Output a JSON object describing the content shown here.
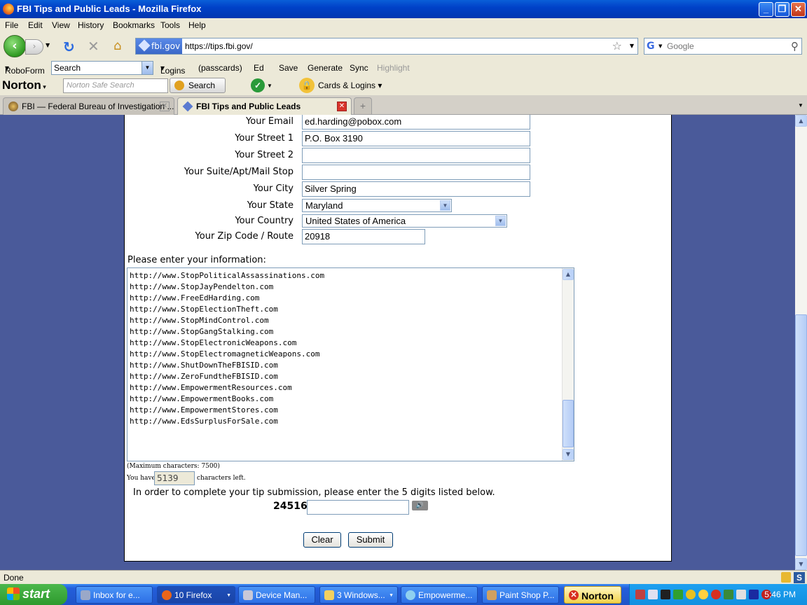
{
  "window": {
    "title": "FBI Tips and Public Leads - Mozilla Firefox"
  },
  "menubar": [
    "File",
    "Edit",
    "View",
    "History",
    "Bookmarks",
    "Tools",
    "Help"
  ],
  "navbar": {
    "site_badge": "fbi.gov",
    "url": "https://tips.fbi.gov/",
    "search_placeholder": "Google"
  },
  "roboform": {
    "brand": "RoboForm",
    "search_value": "Search",
    "logins": "Logins",
    "passcards": "(passcards)",
    "user": "Ed",
    "save": "Save",
    "generate": "Generate",
    "sync": "Sync",
    "highlight": "Highlight"
  },
  "norton": {
    "logo": "Norton",
    "search_placeholder": "Norton Safe Search",
    "search_button": "Search",
    "cards_logins": "Cards & Logins"
  },
  "tabs": [
    {
      "label": "FBI — Federal Bureau of Investigation ...",
      "active": false
    },
    {
      "label": "FBI Tips and Public Leads",
      "active": true
    }
  ],
  "form": {
    "fields": [
      {
        "label": "Your Email",
        "value": "ed.harding@pobox.com"
      },
      {
        "label": "Your Street 1",
        "value": "P.O. Box 3190"
      },
      {
        "label": "Your Street 2",
        "value": ""
      },
      {
        "label": "Your Suite/Apt/Mail Stop",
        "value": ""
      },
      {
        "label": "Your City",
        "value": "Silver Spring"
      }
    ],
    "state": {
      "label": "Your State",
      "value": "Maryland"
    },
    "country": {
      "label": "Your Country",
      "value": "United States of America"
    },
    "zip": {
      "label": "Your Zip Code / Route",
      "value": "20918"
    },
    "info_label": "Please enter your information:",
    "info_lines": [
      "http://www.StopPoliticalAssassinations.com",
      "http://www.StopJayPendelton.com",
      "http://www.FreeEdHarding.com",
      "http://www.StopElectionTheft.com",
      "http://www.StopMindControl.com",
      "http://www.StopGangStalking.com",
      "http://www.StopElectronicWeapons.com",
      "http://www.StopElectromagneticWeapons.com",
      "http://www.ShutDownTheFBISID.com",
      "http://www.ZeroFundtheFBISID.com",
      "http://www.EmpowermentResources.com",
      "http://www.EmpowermentBooks.com",
      "http://www.EmpowermentStores.com",
      "http://www.EdsSurplusForSale.com"
    ],
    "max_chars": "(Maximum characters: 7500)",
    "you_have": "You have",
    "chars_remaining": "5139",
    "chars_left": "characters left.",
    "instruction": "In order to complete your tip submission, please enter the 5 digits listed below.",
    "captcha_digits": "24516",
    "clear_button": "Clear",
    "submit_button": "Submit"
  },
  "status": {
    "text": "Done"
  },
  "taskbar": {
    "start": "start",
    "tasks": [
      {
        "label": "Inbox for e...",
        "color": "#9aa8c8"
      },
      {
        "label": "10 Firefox",
        "color": "#e8651a"
      },
      {
        "label": "Device Man...",
        "color": "#c8c8d8"
      },
      {
        "label": "3 Windows...",
        "color": "#f2d060"
      },
      {
        "label": "Empowerme...",
        "color": "#8fd0f0"
      },
      {
        "label": "Paint Shop P...",
        "color": "#d0a060"
      },
      {
        "label": "Norton",
        "color": "#d83020"
      }
    ],
    "clock": "5:46 PM"
  }
}
